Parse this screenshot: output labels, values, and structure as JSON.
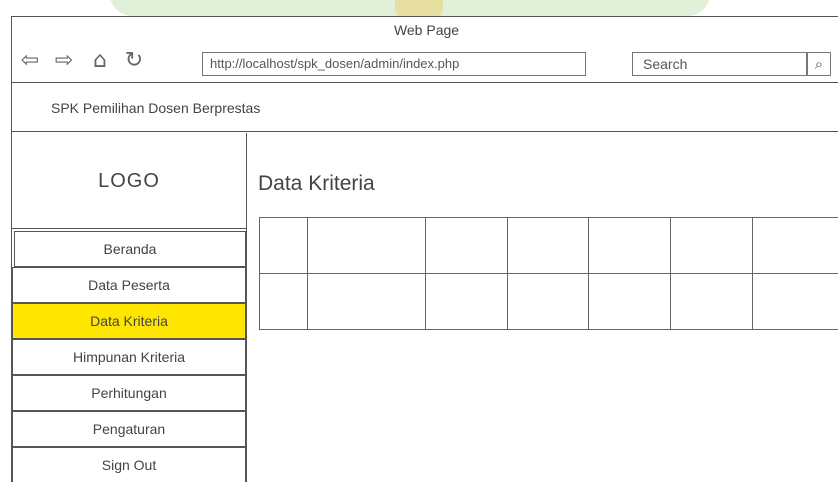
{
  "browser": {
    "title": "Web Page",
    "url": "http://localhost/spk_dosen/admin/index.php",
    "search_placeholder": "Search",
    "icons": [
      "back-arrow-icon",
      "forward-arrow-icon",
      "home-icon",
      "refresh-icon",
      "search-icon"
    ]
  },
  "app": {
    "title": "SPK Pemilihan Dosen Berprestas"
  },
  "sidebar": {
    "logo": "LOGO",
    "items": [
      {
        "label": "Beranda",
        "active": false
      },
      {
        "label": "Data Peserta",
        "active": false
      },
      {
        "label": "Data Kriteria",
        "active": true
      },
      {
        "label": "Himpunan Kriteria",
        "active": false
      },
      {
        "label": "Perhitungan",
        "active": false
      },
      {
        "label": "Pengaturan",
        "active": false
      },
      {
        "label": "Sign Out",
        "active": false
      }
    ]
  },
  "main": {
    "title": "Data Kriteria",
    "table": {
      "rows": 2,
      "cols": 7,
      "cells": [
        [
          "",
          "",
          "",
          "",
          "",
          "",
          ""
        ],
        [
          "",
          "",
          "",
          "",
          "",
          "",
          ""
        ]
      ]
    }
  },
  "colors": {
    "active_menu": "#ffe600",
    "border": "#555555"
  }
}
